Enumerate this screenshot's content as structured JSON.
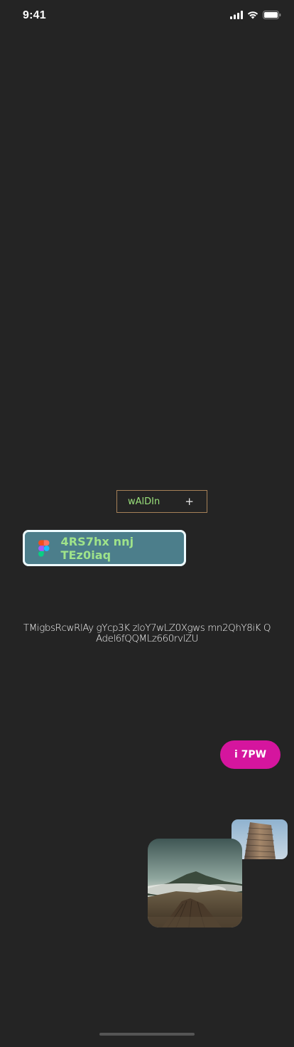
{
  "status_bar": {
    "time": "9:41",
    "icons": [
      "signal-icon",
      "wifi-icon",
      "battery-icon"
    ]
  },
  "chip": {
    "label": "wAlDIn",
    "plus": "+",
    "border_color": "#a68158",
    "text_color": "#9be27c"
  },
  "figma_button": {
    "label": "4RS7hx nnj TEz0iaq",
    "icon": "figma-logo-icon",
    "background": "#4c7e8b",
    "text_color": "#9fe38a"
  },
  "paragraph": {
    "text": "TMigbsRcwRlAy gYcp3K zloY7wLZ0Xgws mn2QhY8iK Q Adel6fQQMLz660rvlZU"
  },
  "pill_button": {
    "label": "i 7PW",
    "background": "#d5159e"
  },
  "images": {
    "building": "building-photo",
    "volcano": "volcano-landscape-photo"
  }
}
